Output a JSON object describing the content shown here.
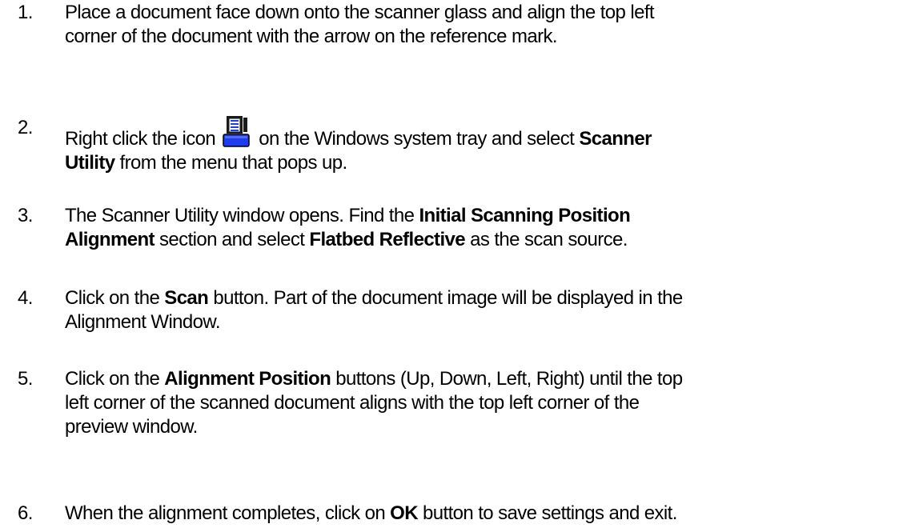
{
  "steps": [
    {
      "number": "1.",
      "line1": "Place a document face down onto the scanner glass and align the top left",
      "line2": "corner of the document with the arrow on the reference mark."
    },
    {
      "number": "2.",
      "pre_icon": "Right click the icon",
      "icon": "scanner-tray-icon",
      "post_icon": "on the Windows system tray and select",
      "bold1": "Scanner",
      "bold2": "Utility",
      "rest": "from the menu that pops up."
    },
    {
      "number": "3.",
      "pre": "The Scanner Utility window opens.  Find the",
      "bold1": "Initial Scanning Position",
      "bold2": "Alignment",
      "mid": "section and select",
      "bold3": "Flatbed Reflective",
      "post": "as the scan source."
    },
    {
      "number": "4.",
      "pre": "Click on the",
      "bold1": "Scan",
      "post": "button.  Part of the document image will be displayed in the",
      "line2": "Alignment Window."
    },
    {
      "number": "5.",
      "pre": "Click on the",
      "bold1": "Alignment Position",
      "post": "buttons  (Up, Down, Left, Right) until the top",
      "line2": "left corner of the scanned document aligns with the top left corner of the",
      "line3": "preview window."
    },
    {
      "number": "6.",
      "pre": "When the alignment completes, click on",
      "bold1": "OK",
      "post": "button to save settings and exit."
    }
  ],
  "colors": {
    "text": "#000000",
    "icon_blue": "#1e3cf0",
    "icon_dark": "#1a1a1a"
  }
}
